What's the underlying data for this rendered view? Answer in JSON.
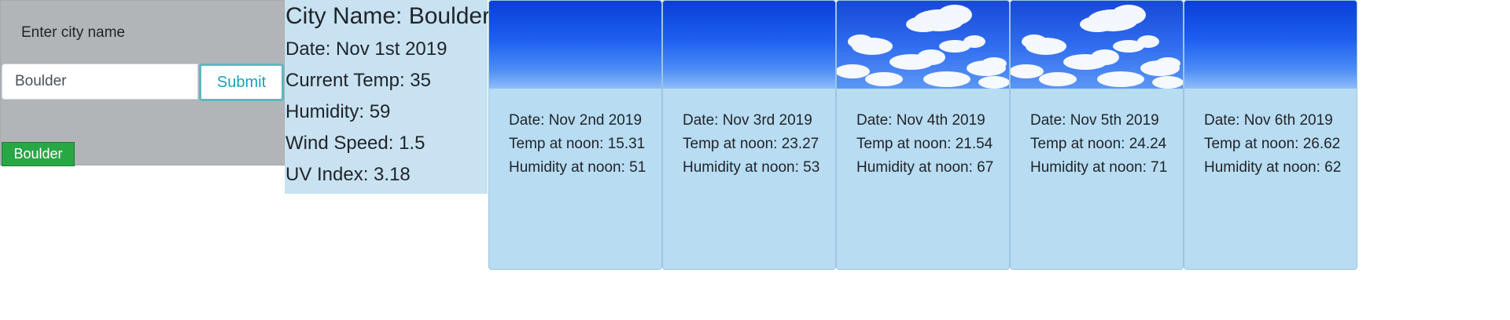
{
  "search": {
    "label": "Enter city name",
    "input_value": "Boulder",
    "input_placeholder": "",
    "submit_label": "Submit",
    "history": [
      "Boulder"
    ]
  },
  "current": {
    "city": "City Name: Boulder",
    "date": "Date: Nov 1st 2019",
    "temp": "Current Temp: 35",
    "humidity": "Humidity: 59",
    "wind": "Wind Speed: 1.5",
    "uv": "UV Index: 3.18"
  },
  "forecast": [
    {
      "icon": "clear-sky-image",
      "date": "Date: Nov 2nd 2019",
      "temp": "Temp at noon: 15.31",
      "humidity": "Humidity at noon: 51"
    },
    {
      "icon": "clear-sky-image",
      "date": "Date: Nov 3rd 2019",
      "temp": "Temp at noon: 23.27",
      "humidity": "Humidity at noon: 53"
    },
    {
      "icon": "cloudy-sky-image",
      "date": "Date: Nov 4th 2019",
      "temp": "Temp at noon: 21.54",
      "humidity": "Humidity at noon: 67"
    },
    {
      "icon": "cloudy-sky-image",
      "date": "Date: Nov 5th 2019",
      "temp": "Temp at noon: 24.24",
      "humidity": "Humidity at noon: 71"
    },
    {
      "icon": "clear-sky-image",
      "date": "Date: Nov 6th 2019",
      "temp": "Temp at noon: 26.62",
      "humidity": "Humidity at noon: 62"
    }
  ],
  "colors": {
    "panel_bg": "#b2b5b8",
    "current_bg": "#c8e2f2",
    "card_bg": "#b8dcf2",
    "submit_text": "#17a2b8",
    "history_bg": "#28a745"
  }
}
